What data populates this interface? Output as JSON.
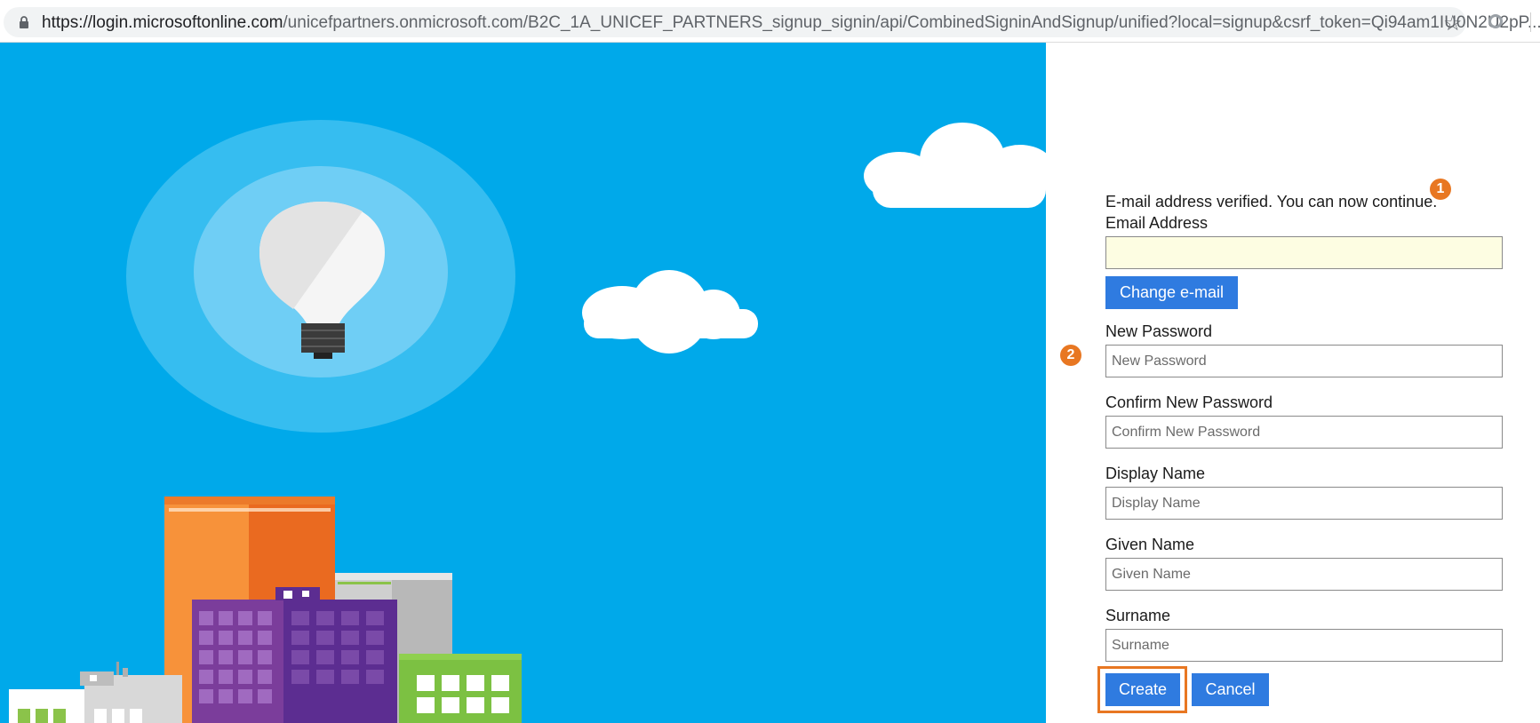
{
  "browser": {
    "url_host": "https://login.microsoftonline.com",
    "url_path": "/unicefpartners.onmicrosoft.com/B2C_1A_UNICEF_PARTNERS_signup_signin/api/CombinedSigninAndSignup/unified?local=signup&csrf_token=Qi94am1IU0N2U2pP...",
    "icons": [
      "lock-icon",
      "star-icon",
      "extension-icon"
    ]
  },
  "form": {
    "verified_message": "E-mail address verified. You can now continue.",
    "email_label": "Email Address",
    "email_value": "",
    "change_email_label": "Change e-mail",
    "new_password_label": "New Password",
    "new_password_placeholder": "New Password",
    "confirm_password_label": "Confirm New Password",
    "confirm_password_placeholder": "Confirm New Password",
    "display_name_label": "Display Name",
    "display_name_placeholder": "Display Name",
    "given_name_label": "Given Name",
    "given_name_placeholder": "Given Name",
    "surname_label": "Surname",
    "surname_placeholder": "Surname",
    "create_label": "Create",
    "cancel_label": "Cancel"
  },
  "annotations": {
    "badge_1": "1",
    "badge_2": "2",
    "color": "#e87722"
  },
  "colors": {
    "hero_sky": "#00a9ea",
    "button_blue": "#2f7be0",
    "email_field_bg": "#fdfde2"
  }
}
